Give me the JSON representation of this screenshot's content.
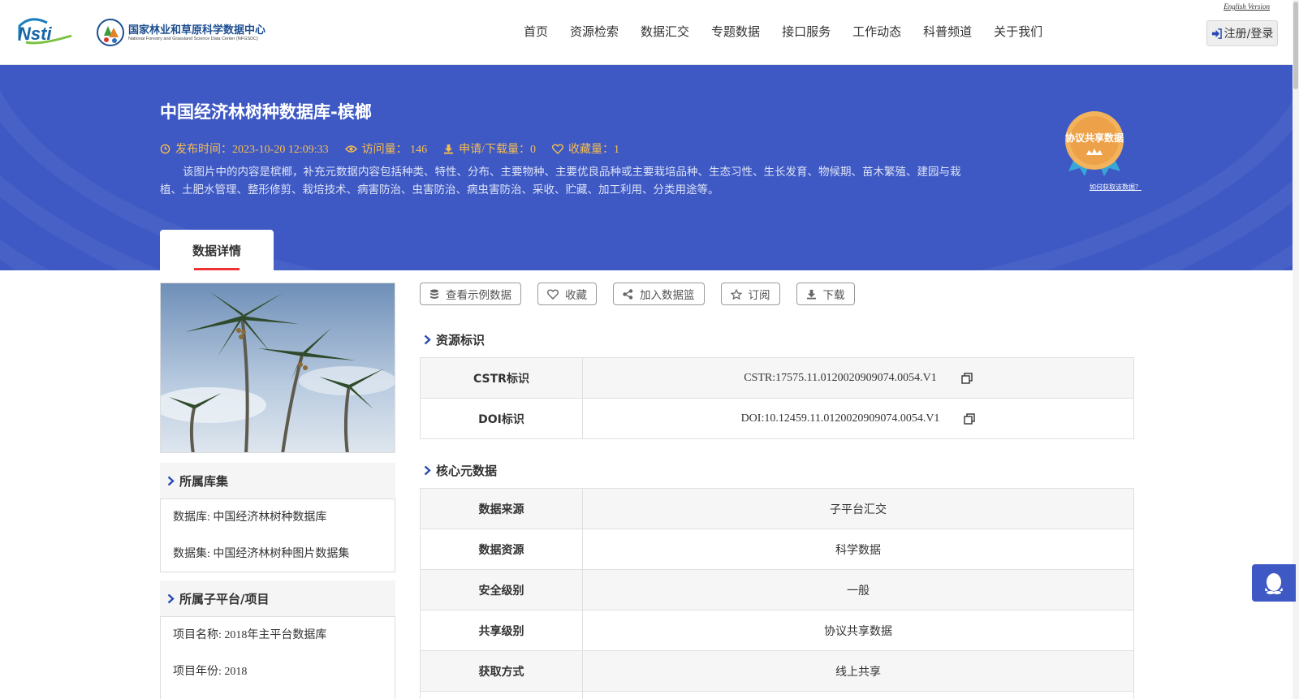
{
  "header": {
    "english_link": "English Version",
    "logo_nsti_text": "Nsti",
    "logo_cn": "国家林业和草原科学数据中心",
    "logo_en": "National Forestry and Grassland Science Data Center (NFGSDC)",
    "nav": [
      "首页",
      "资源检索",
      "数据汇交",
      "专题数据",
      "接口服务",
      "工作动态",
      "科普频道",
      "关于我们"
    ],
    "login_label": "注册/登录"
  },
  "banner": {
    "title": "中国经济林树种数据库-槟榔",
    "publish_time": "发布时间：2023-10-20 12:09:33",
    "visits": "访问量： 146",
    "downloads": "申请/下载量：0",
    "favorites": "收藏量：1",
    "description": "该图片中的内容是槟榔，补充元数据内容包括种类、特性、分布、主要物种、主要优良品种或主要栽培品种、生态习性、生长发育、物候期、苗木繁殖、建园与栽植、土肥水管理、整形修剪、栽培技术、病害防治、虫害防治、病虫害防治、采收、贮藏、加工利用、分类用途等。",
    "badge_label": "协议共享数据",
    "how_link": "如何获取该数据？",
    "active_tab": "数据详情"
  },
  "sidebar": {
    "library_title": "所属库集",
    "library_items": [
      "数据库: 中国经济林树种数据库",
      "数据集: 中国经济林树种图片数据集"
    ],
    "project_title": "所属子平台/项目",
    "project_items": [
      "项目名称: 2018年主平台数据库",
      "项目年份: 2018"
    ]
  },
  "actions": [
    "查看示例数据",
    "收藏",
    "加入数据篮",
    "订阅",
    "下载"
  ],
  "resource_id": {
    "title": "资源标识",
    "rows": [
      {
        "label": "CSTR标识",
        "value": "CSTR:17575.11.0120020909074.0054.V1"
      },
      {
        "label": "DOI标识",
        "value": "DOI:10.12459.11.0120020909074.0054.V1"
      }
    ]
  },
  "core_meta": {
    "title": "核心元数据",
    "rows": [
      {
        "label": "数据来源",
        "value": "子平台汇交"
      },
      {
        "label": "数据资源",
        "value": "科学数据"
      },
      {
        "label": "安全级别",
        "value": "一般"
      },
      {
        "label": "共享级别",
        "value": "协议共享数据"
      },
      {
        "label": "获取方式",
        "value": "线上共享"
      },
      {
        "label": "",
        "value": ""
      }
    ]
  },
  "colors": {
    "banner": "#3e59c4",
    "meta": "#f7bd4e",
    "accent_red": "#e33333",
    "chevron": "#2a4bb5"
  }
}
